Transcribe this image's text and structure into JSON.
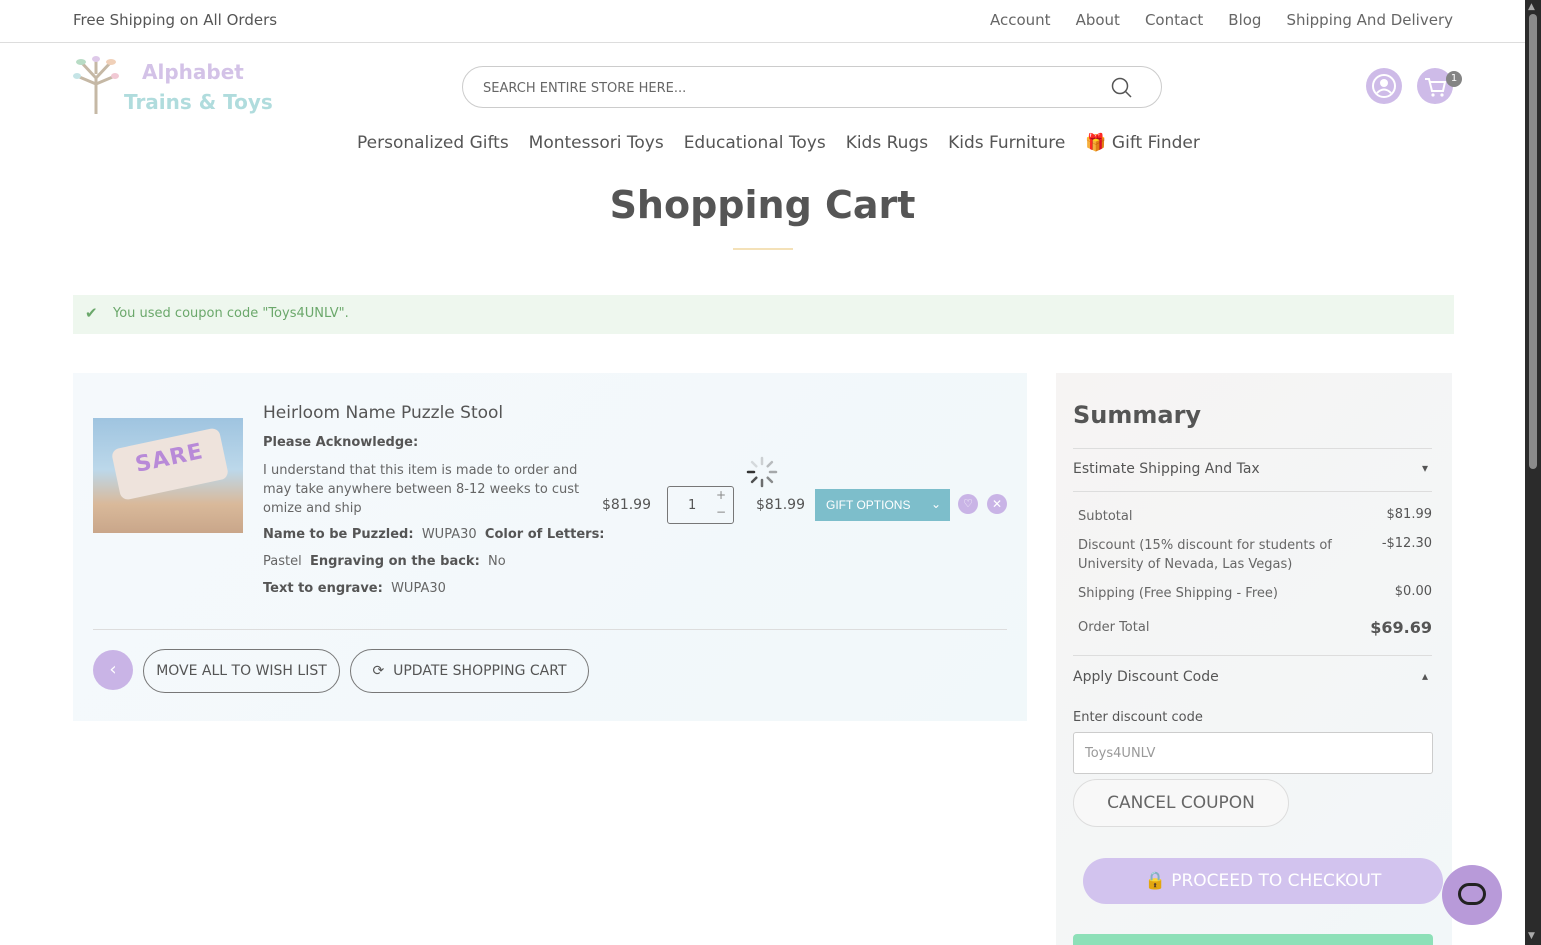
{
  "topbar": {
    "shipping_text": "Free Shipping on All Orders",
    "links": [
      "Account",
      "About",
      "Contact",
      "Blog",
      "Shipping And Delivery"
    ]
  },
  "logo": {
    "line1": "Alphabet",
    "line2": "Trains & Toys"
  },
  "search": {
    "placeholder": "SEARCH ENTIRE STORE HERE..."
  },
  "header": {
    "cart_count": "1"
  },
  "nav": {
    "items": [
      "Personalized Gifts",
      "Montessori Toys",
      "Educational Toys",
      "Kids Rugs",
      "Kids Furniture"
    ],
    "gift_finder": "Gift Finder"
  },
  "page": {
    "title": "Shopping Cart"
  },
  "message": {
    "text": "You used coupon code \"Toys4UNLV\"."
  },
  "cart": {
    "item": {
      "name": "Heirloom Name Puzzle Stool",
      "acknowledge_label": "Please Acknowledge:",
      "acknowledge_text": "I understand that this item is made to order and may take anywhere between 8-12 weeks to customize and ship",
      "opt_name_label": "Name to be Puzzled:",
      "opt_name_value": "WUPA30",
      "opt_color_label": "Color of Letters:",
      "opt_color_value": "Pastel",
      "opt_engrave_label": "Engraving on the back:",
      "opt_engrave_value": "No",
      "opt_text_label": "Text to engrave:",
      "opt_text_value": "WUPA30",
      "price": "$81.99",
      "qty": "1",
      "subtotal": "$81.99",
      "gift_options_label": "GIFT OPTIONS"
    },
    "move_all_label": "MOVE ALL TO WISH LIST",
    "update_label": "UPDATE SHOPPING CART"
  },
  "summary": {
    "title": "Summary",
    "estimate_label": "Estimate Shipping And Tax",
    "subtotal_label": "Subtotal",
    "subtotal_value": "$81.99",
    "discount_label": "Discount (15% discount for students of University of Nevada, Las Vegas)",
    "discount_value": "-$12.30",
    "shipping_label": "Shipping (Free Shipping - Free)",
    "shipping_value": "$0.00",
    "total_label": "Order Total",
    "total_value": "$69.69",
    "apply_label": "Apply Discount Code",
    "enter_label": "Enter discount code",
    "discount_code": "Toys4UNLV",
    "cancel_label": "CANCEL COUPON",
    "checkout_label": "PROCEED TO CHECKOUT"
  },
  "colors": {
    "accent_purple": "#c9b4e6",
    "teal": "#7dbecb",
    "success_green": "#6ba86b"
  }
}
